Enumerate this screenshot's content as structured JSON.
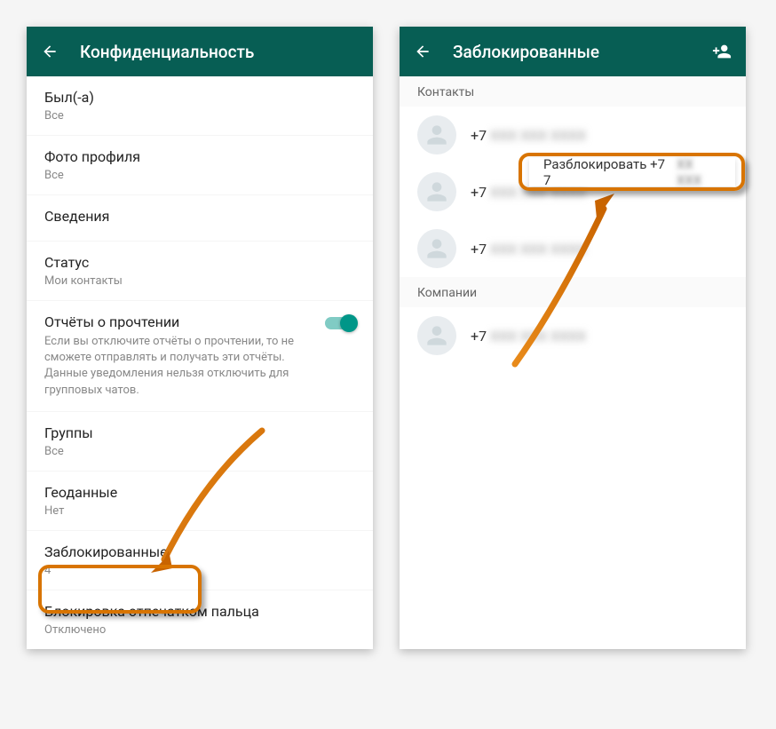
{
  "accent_color": "#075E54",
  "highlight_color": "#d87400",
  "left": {
    "title": "Конфиденциальность",
    "rows": {
      "last_seen": {
        "title": "Был(-а)",
        "sub": "Все"
      },
      "photo": {
        "title": "Фото профиля",
        "sub": "Все"
      },
      "about": {
        "title": "Сведения",
        "sub": ""
      },
      "status": {
        "title": "Статус",
        "sub": "Мои контакты"
      },
      "read_receipts": {
        "title": "Отчёты о прочтении",
        "desc": "Если вы отключите отчёты о прочтении, то не сможете отправлять и получать эти отчёты. Данные уведомления нельзя отключить для групповых чатов.",
        "enabled": true
      },
      "groups": {
        "title": "Группы",
        "sub": "Все"
      },
      "geo": {
        "title": "Геоданные",
        "sub": "Нет"
      },
      "blocked": {
        "title": "Заблокированные",
        "sub": "4"
      },
      "fingerprint": {
        "title": "Блокировка отпечатком пальца",
        "sub": "Отключено"
      }
    }
  },
  "right": {
    "title": "Заблокированные",
    "sections": {
      "contacts": {
        "label": "Контакты",
        "items": [
          {
            "prefix": "+7",
            "rest": "XXX XXX XXXX"
          },
          {
            "prefix": "+7",
            "rest": "XXX XXX XXXX"
          },
          {
            "prefix": "+7",
            "rest": "XXX XXX XXXX"
          }
        ]
      },
      "companies": {
        "label": "Компании",
        "items": [
          {
            "prefix": "+7",
            "rest": "XXX XXX XXXX"
          }
        ]
      }
    },
    "popup": {
      "label": "Разблокировать +7 7",
      "rest": "XX XXX"
    }
  }
}
